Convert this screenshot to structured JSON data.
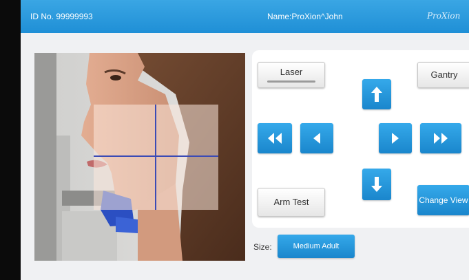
{
  "header": {
    "id_label": "ID No. 99999993",
    "name_label": "Name:ProXion^John",
    "logo": "ProXion"
  },
  "controls": {
    "laser_label": "Laser",
    "gantry_label": "Gantry",
    "arm_test_label": "Arm Test",
    "change_view_label": "Change View",
    "icons": [
      "arrow-up-icon",
      "arrow-down-icon",
      "arrow-left-icon",
      "arrow-right-icon",
      "double-arrow-left-icon",
      "double-arrow-right-icon"
    ]
  },
  "size": {
    "label": "Size:",
    "value": "Medium Adult"
  },
  "colors": {
    "header": "#2a9ae0",
    "button_blue": "#1f8fd6",
    "background": "#f0f1f3",
    "crosshair": "#3b4bb5"
  }
}
